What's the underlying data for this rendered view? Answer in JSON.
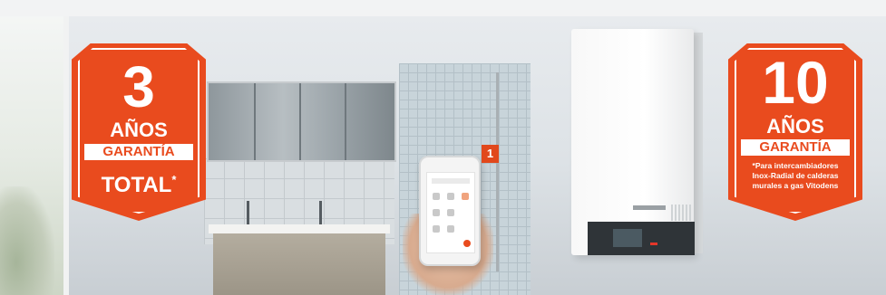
{
  "left_badge": {
    "number": "3",
    "unit": "AÑOS",
    "label": "GARANTÍA",
    "scope": "TOTAL",
    "mark": "*"
  },
  "right_badge": {
    "number": "10",
    "unit": "AÑOS",
    "label": "GARANTÍA",
    "note_line1": "*Para intercambiadores",
    "note_line2": "Inox-Radial de calderas",
    "note_line3": "murales a gas Vitodens"
  },
  "callout": {
    "number": "1"
  },
  "colors": {
    "brand": "#e94b1e",
    "callout": "#e1481c"
  }
}
